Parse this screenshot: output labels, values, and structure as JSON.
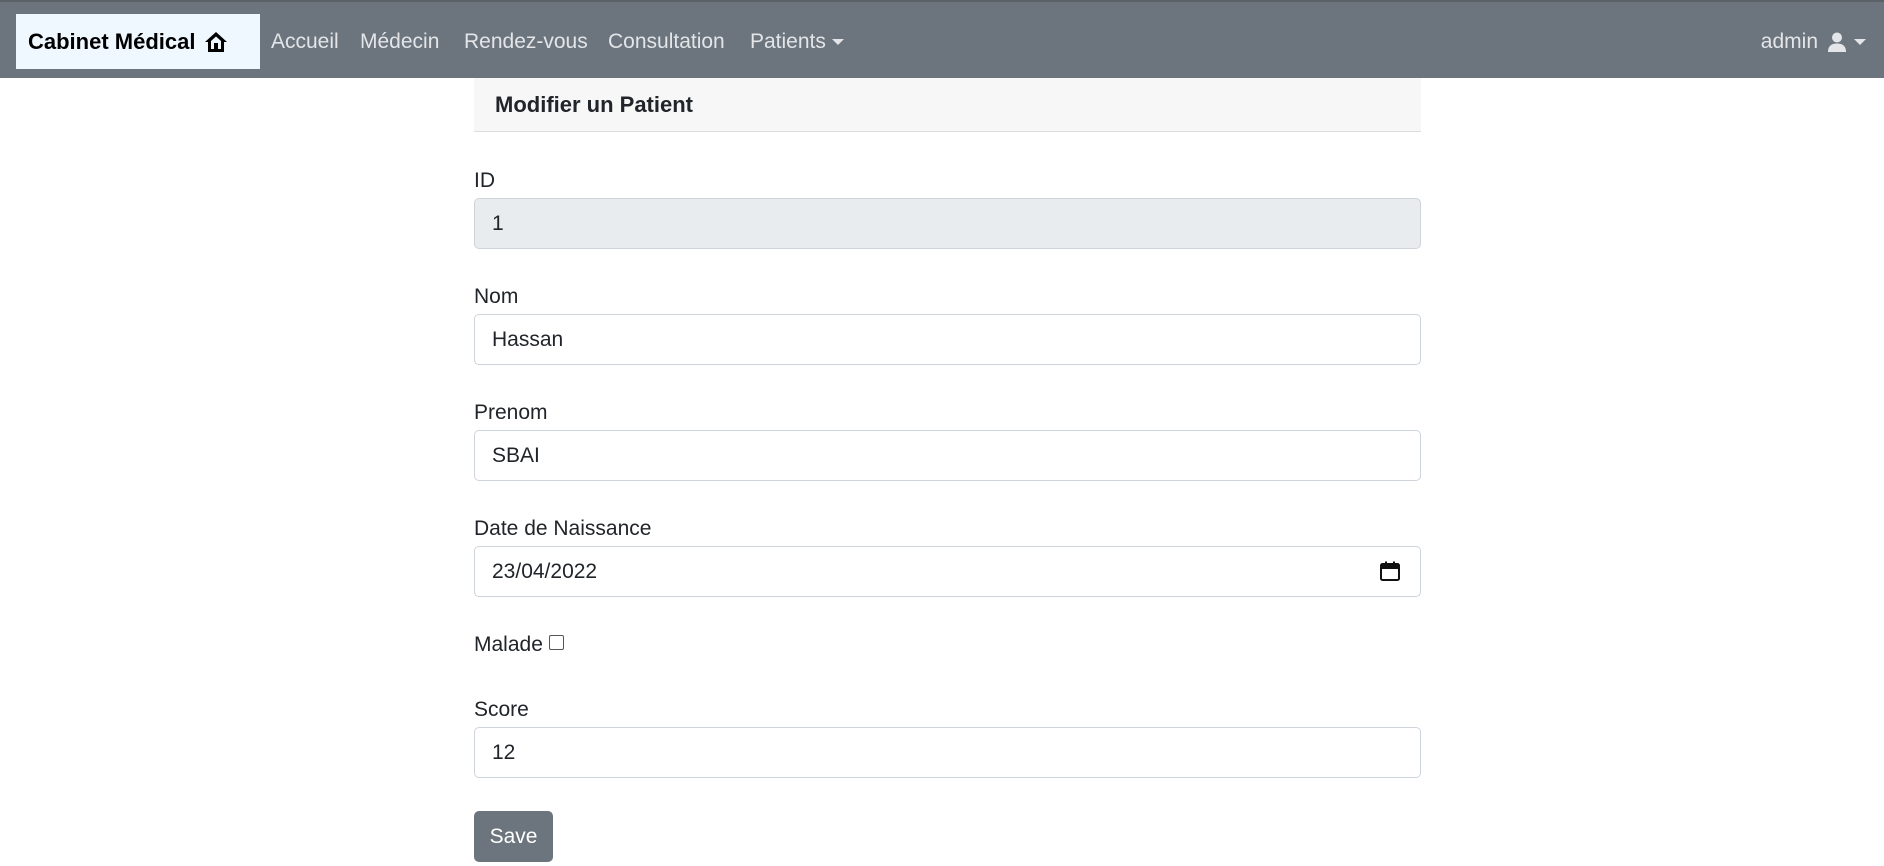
{
  "navbar": {
    "brand": "Cabinet Médical",
    "brand_icon": "home-icon",
    "links": [
      "Accueil",
      "Médecin",
      "Rendez-vous",
      "Consultation",
      "Patients"
    ],
    "user": "admin",
    "user_icon": "user-icon",
    "bg_color": "#6c757d"
  },
  "form": {
    "header": "Modifier un Patient",
    "id_label": "ID",
    "id_value": "1",
    "nom_label": "Nom",
    "nom_value": "Hassan",
    "prenom_label": "Prenom",
    "prenom_value": "SBAI",
    "date_label": "Date de Naissance",
    "date_value": "23/04/2022",
    "date_icon": "calendar-icon",
    "malade_label": "Malade",
    "malade_checked": false,
    "score_label": "Score",
    "score_value": "12",
    "save_label": "Save"
  }
}
